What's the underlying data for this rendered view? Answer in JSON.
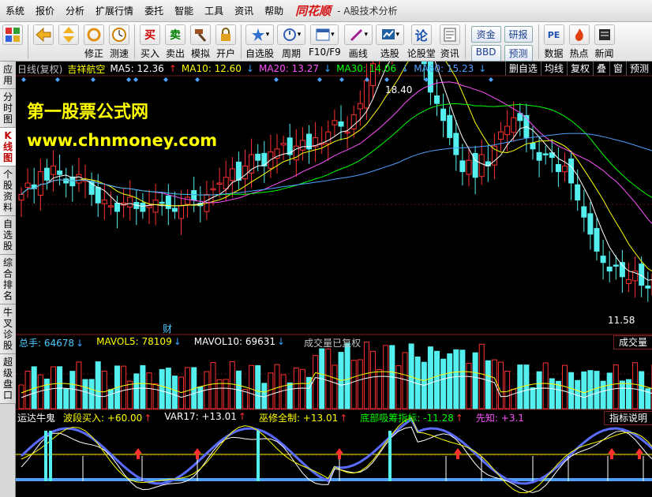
{
  "menubar": {
    "items": [
      "系统",
      "报价",
      "分析",
      "扩展行情",
      "委托",
      "智能",
      "工具",
      "资讯",
      "帮助"
    ],
    "logo": "同花顺",
    "title": "- A股技术分析"
  },
  "toolbar": {
    "buttons": [
      {
        "label": "",
        "icon": "grid-icon"
      },
      {
        "label": "",
        "icon": "back-arrow-icon"
      },
      {
        "label": "",
        "icon": "updown-arrow-icon"
      },
      {
        "label": "修正",
        "icon": "refresh-icon"
      },
      {
        "label": "测速",
        "icon": "clock-icon"
      },
      {
        "label": "买入",
        "icon": "buy-icon",
        "glyph": "买"
      },
      {
        "label": "卖出",
        "icon": "sell-icon",
        "glyph": "卖"
      },
      {
        "label": "模拟",
        "icon": "hammer-icon"
      },
      {
        "label": "开户",
        "icon": "lock-icon"
      },
      {
        "label": "自选股",
        "icon": "star-icon"
      },
      {
        "label": "周期",
        "icon": "period-icon"
      },
      {
        "label": "F10/F9",
        "icon": "f10-icon"
      },
      {
        "label": "画线",
        "icon": "pen-icon"
      },
      {
        "label": "选股",
        "icon": "filter-icon"
      },
      {
        "label": "论股堂",
        "icon": "forum-icon",
        "glyph": "论"
      },
      {
        "label": "资讯",
        "icon": "news-icon"
      }
    ],
    "box_buttons": [
      "资金",
      "研报",
      "BBD",
      "预测"
    ],
    "right_buttons": [
      {
        "label": "数据",
        "icon": "pe-icon",
        "glyph": "PE"
      },
      {
        "label": "热点",
        "icon": "hot-icon"
      },
      {
        "label": "新闻",
        "icon": "news-icon"
      }
    ]
  },
  "sidetabs": [
    "应用",
    "分时图",
    "K线图",
    "个股资料",
    "自选股",
    "综合排名",
    "牛叉诊股",
    "超级盘口"
  ],
  "main": {
    "period": "日线(复权)",
    "stock": "吉祥航空",
    "ma": [
      {
        "name": "MA5",
        "value": "12.36",
        "dir": "up",
        "color": "#ffffff"
      },
      {
        "name": "MA10",
        "value": "12.60",
        "dir": "dn",
        "color": "#ffff00"
      },
      {
        "name": "MA20",
        "value": "13.27",
        "dir": "dn",
        "color": "#ff50ff"
      },
      {
        "name": "MA30",
        "value": "14.06",
        "dir": "dn",
        "color": "#00ff00"
      },
      {
        "name": "MA60",
        "value": "15.23",
        "dir": "dn",
        "color": "#4fa0ff"
      }
    ],
    "right_buttons": [
      "删自选",
      "均线",
      "复权",
      "叠",
      "窗",
      "预测"
    ],
    "high_label": "18.40",
    "low_label": "11.58",
    "cai_label": "财",
    "watermark_title": "第一股票公式网",
    "watermark_url": "www.chnmoney.com"
  },
  "volume": {
    "items": [
      {
        "text": "总手: 64678",
        "dir": "dn",
        "color": "#4fc8ff"
      },
      {
        "text": "MAVOL5: 78109",
        "dir": "dn",
        "color": "#ffff00"
      },
      {
        "text": "MAVOL10: 69631",
        "dir": "dn",
        "color": "#ffffff"
      }
    ],
    "note": "成交量已复权",
    "label": "成交量"
  },
  "indicator": {
    "name": "运达牛鬼",
    "items": [
      {
        "text": "波段买入: +60.00",
        "dir": "up",
        "color": "#ffff00"
      },
      {
        "text": "VAR17: +13.01",
        "dir": "up",
        "color": "#ffffff"
      },
      {
        "text": "巫修全制: +13.01",
        "dir": "up",
        "color": "#ffff00"
      },
      {
        "text": "底部吸筹指标: -11.28",
        "dir": "up",
        "color": "#00ff00"
      },
      {
        "text": "先知: +3.1",
        "dir": "",
        "color": "#ff50ff"
      }
    ],
    "label": "指标说明"
  },
  "colors": {
    "up": "#ff3030",
    "down": "#54f0f0",
    "ma5": "#ffffff",
    "ma10": "#ffff00",
    "ma20": "#ff50ff",
    "ma30": "#00ff00",
    "ma60": "#4fa0ff"
  }
}
